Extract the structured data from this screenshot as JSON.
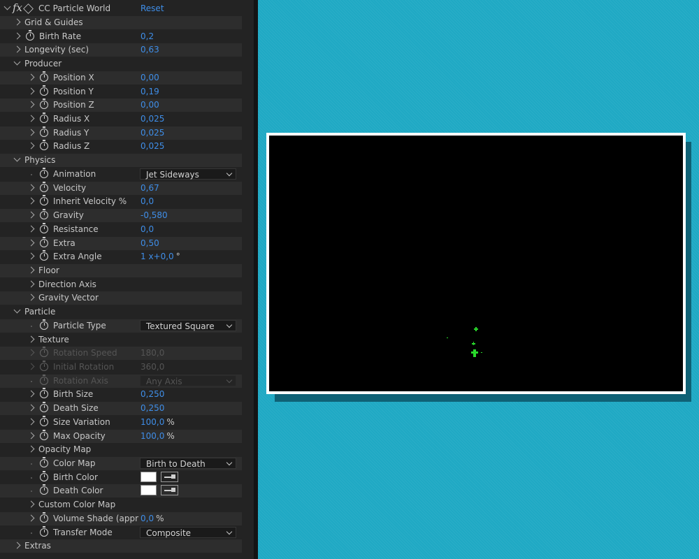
{
  "effect": {
    "name": "CC Particle World",
    "reset_label": "Reset",
    "fx_glyph": "fx"
  },
  "properties": [
    {
      "id": "grid-guides",
      "label": "Grid & Guides",
      "indent": 1,
      "expander": "collapsed"
    },
    {
      "id": "birth-rate",
      "label": "Birth Rate",
      "indent": 1,
      "expander": "collapsed",
      "stopwatch": true,
      "value": "0,2"
    },
    {
      "id": "longevity",
      "label": "Longevity (sec)",
      "indent": 1,
      "expander": "collapsed",
      "value": "0,63"
    },
    {
      "id": "producer",
      "label": "Producer",
      "indent": 1,
      "expander": "expanded"
    },
    {
      "id": "position-x",
      "label": "Position X",
      "indent": 2,
      "expander": "collapsed",
      "stopwatch": true,
      "value": "0,00"
    },
    {
      "id": "position-y",
      "label": "Position Y",
      "indent": 2,
      "expander": "collapsed",
      "stopwatch": true,
      "value": "0,19"
    },
    {
      "id": "position-z",
      "label": "Position Z",
      "indent": 2,
      "expander": "collapsed",
      "stopwatch": true,
      "value": "0,00"
    },
    {
      "id": "radius-x",
      "label": "Radius X",
      "indent": 2,
      "expander": "collapsed",
      "stopwatch": true,
      "value": "0,025"
    },
    {
      "id": "radius-y",
      "label": "Radius Y",
      "indent": 2,
      "expander": "collapsed",
      "stopwatch": true,
      "value": "0,025"
    },
    {
      "id": "radius-z",
      "label": "Radius Z",
      "indent": 2,
      "expander": "collapsed",
      "stopwatch": true,
      "value": "0,025"
    },
    {
      "id": "physics",
      "label": "Physics",
      "indent": 1,
      "expander": "expanded"
    },
    {
      "id": "animation",
      "label": "Animation",
      "indent": 2,
      "expander": "none",
      "stopwatch": true,
      "dropdown": "Jet Sideways"
    },
    {
      "id": "velocity",
      "label": "Velocity",
      "indent": 2,
      "expander": "collapsed",
      "stopwatch": true,
      "value": "0,67"
    },
    {
      "id": "inherit-velocity",
      "label": "Inherit Velocity %",
      "indent": 2,
      "expander": "collapsed",
      "stopwatch": true,
      "value": "0,0"
    },
    {
      "id": "gravity",
      "label": "Gravity",
      "indent": 2,
      "expander": "collapsed",
      "stopwatch": true,
      "value": "-0,580"
    },
    {
      "id": "resistance",
      "label": "Resistance",
      "indent": 2,
      "expander": "collapsed",
      "stopwatch": true,
      "value": "0,0"
    },
    {
      "id": "extra",
      "label": "Extra",
      "indent": 2,
      "expander": "collapsed",
      "stopwatch": true,
      "value": "0,50"
    },
    {
      "id": "extra-angle",
      "label": "Extra Angle",
      "indent": 2,
      "expander": "collapsed",
      "stopwatch": true,
      "value": "1 x+0,0",
      "unit": "°"
    },
    {
      "id": "floor",
      "label": "Floor",
      "indent": 2,
      "expander": "collapsed"
    },
    {
      "id": "direction-axis",
      "label": "Direction Axis",
      "indent": 2,
      "expander": "collapsed"
    },
    {
      "id": "gravity-vector",
      "label": "Gravity Vector",
      "indent": 2,
      "expander": "collapsed"
    },
    {
      "id": "particle",
      "label": "Particle",
      "indent": 1,
      "expander": "expanded"
    },
    {
      "id": "particle-type",
      "label": "Particle Type",
      "indent": 2,
      "expander": "none",
      "stopwatch": true,
      "dropdown": "Textured Square"
    },
    {
      "id": "texture",
      "label": "Texture",
      "indent": 2,
      "expander": "collapsed"
    },
    {
      "id": "rotation-speed",
      "label": "Rotation Speed",
      "indent": 2,
      "expander": "collapsed",
      "stopwatch": true,
      "value": "180,0",
      "disabled": true
    },
    {
      "id": "initial-rotation",
      "label": "Initial Rotation",
      "indent": 2,
      "expander": "collapsed",
      "stopwatch": true,
      "value": "360,0",
      "disabled": true
    },
    {
      "id": "rotation-axis",
      "label": "Rotation Axis",
      "indent": 2,
      "expander": "none",
      "stopwatch": true,
      "dropdown": "Any Axis",
      "disabled": true
    },
    {
      "id": "birth-size",
      "label": "Birth Size",
      "indent": 2,
      "expander": "collapsed",
      "stopwatch": true,
      "value": "0,250"
    },
    {
      "id": "death-size",
      "label": "Death Size",
      "indent": 2,
      "expander": "collapsed",
      "stopwatch": true,
      "value": "0,250"
    },
    {
      "id": "size-variation",
      "label": "Size Variation",
      "indent": 2,
      "expander": "collapsed",
      "stopwatch": true,
      "value": "100,0",
      "unit": "%"
    },
    {
      "id": "max-opacity",
      "label": "Max Opacity",
      "indent": 2,
      "expander": "collapsed",
      "stopwatch": true,
      "value": "100,0",
      "unit": "%"
    },
    {
      "id": "opacity-map",
      "label": "Opacity Map",
      "indent": 2,
      "expander": "collapsed"
    },
    {
      "id": "color-map",
      "label": "Color Map",
      "indent": 2,
      "expander": "none",
      "stopwatch": true,
      "dropdown": "Birth to Death"
    },
    {
      "id": "birth-color",
      "label": "Birth Color",
      "indent": 2,
      "expander": "none",
      "stopwatch": true,
      "color": "#ffffff"
    },
    {
      "id": "death-color",
      "label": "Death Color",
      "indent": 2,
      "expander": "none",
      "stopwatch": true,
      "color": "#ffffff"
    },
    {
      "id": "custom-color-map",
      "label": "Custom Color Map",
      "indent": 2,
      "expander": "collapsed"
    },
    {
      "id": "volume-shade",
      "label": "Volume Shade (appr",
      "indent": 2,
      "expander": "collapsed",
      "stopwatch": true,
      "value": "0,0",
      "unit": "%"
    },
    {
      "id": "transfer-mode",
      "label": "Transfer Mode",
      "indent": 2,
      "expander": "none",
      "stopwatch": true,
      "dropdown": "Composite"
    },
    {
      "id": "extras",
      "label": "Extras",
      "indent": 1,
      "expander": "collapsed"
    }
  ],
  "colors": {
    "value_blue": "#3f8ee8",
    "viewer_bg": "#101010",
    "particle_green": "#29d82b",
    "backdrop": "#1fa9c4"
  }
}
